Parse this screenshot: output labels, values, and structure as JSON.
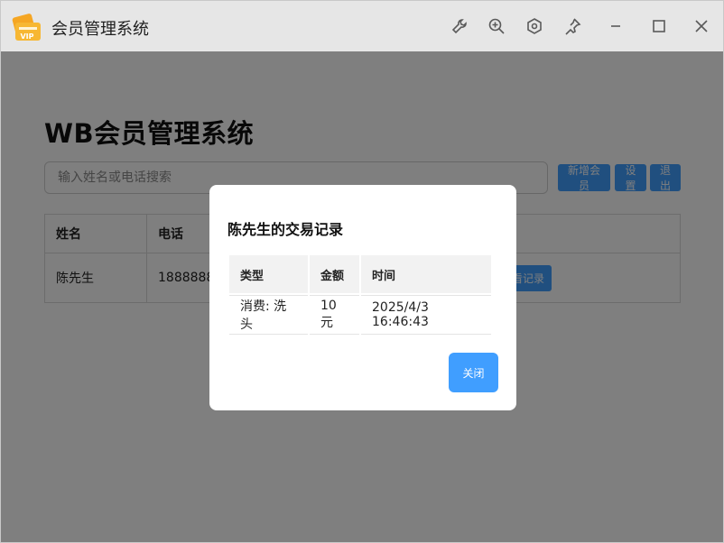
{
  "window": {
    "title": "会员管理系统",
    "app_icon_text": "VIP"
  },
  "titlebar_icons": [
    "wrench-icon",
    "zoom-in-icon",
    "settings-icon",
    "pin-icon",
    "minimize-icon",
    "maximize-icon",
    "close-icon"
  ],
  "main": {
    "heading": "WB会员管理系统",
    "search": {
      "placeholder": "输入姓名或电话搜索",
      "value": ""
    },
    "buttons": {
      "add": "新增会员",
      "settings": "设置",
      "logout": "退出"
    },
    "table": {
      "headers": [
        "姓名",
        "电话",
        ""
      ],
      "rows": [
        {
          "name": "陈先生",
          "phone": "1888888",
          "action": "看记录"
        }
      ]
    }
  },
  "modal": {
    "title": "陈先生的交易记录",
    "headers": [
      "类型",
      "金额",
      "时间"
    ],
    "rows": [
      {
        "type": "消费: 洗头",
        "amount": "10元",
        "time": "2025/4/3 16:46:43"
      }
    ],
    "close_label": "关闭"
  },
  "colors": {
    "accent": "#409eff",
    "icon_orange": "#f5a623",
    "titlebar_bg": "#e6e6e6"
  }
}
